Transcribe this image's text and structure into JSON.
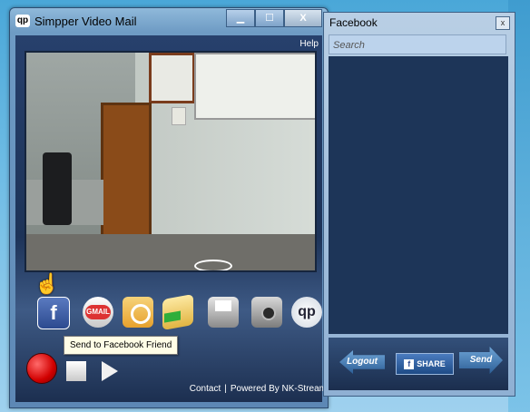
{
  "window": {
    "icon_text": "qp",
    "title": "Simpper Video Mail",
    "minimize": "▁",
    "maximize": "☐",
    "close": "X",
    "help": "Help"
  },
  "toolbar": {
    "facebook_glyph": "f",
    "gmail_text": "GMAIL",
    "logo_text": "qp"
  },
  "tooltip": "Send to Facebook Friend",
  "footer": {
    "contact": "Contact",
    "separator": "|",
    "powered": "Powered By NK-Stream"
  },
  "facebook_panel": {
    "title": "Facebook",
    "close": "x",
    "search_placeholder": "Search",
    "logout": "Logout",
    "share_glyph": "f",
    "share": "SHARE",
    "send": "Send"
  },
  "colors": {
    "record": "#d10000",
    "panel_bg": "#1d3558"
  }
}
